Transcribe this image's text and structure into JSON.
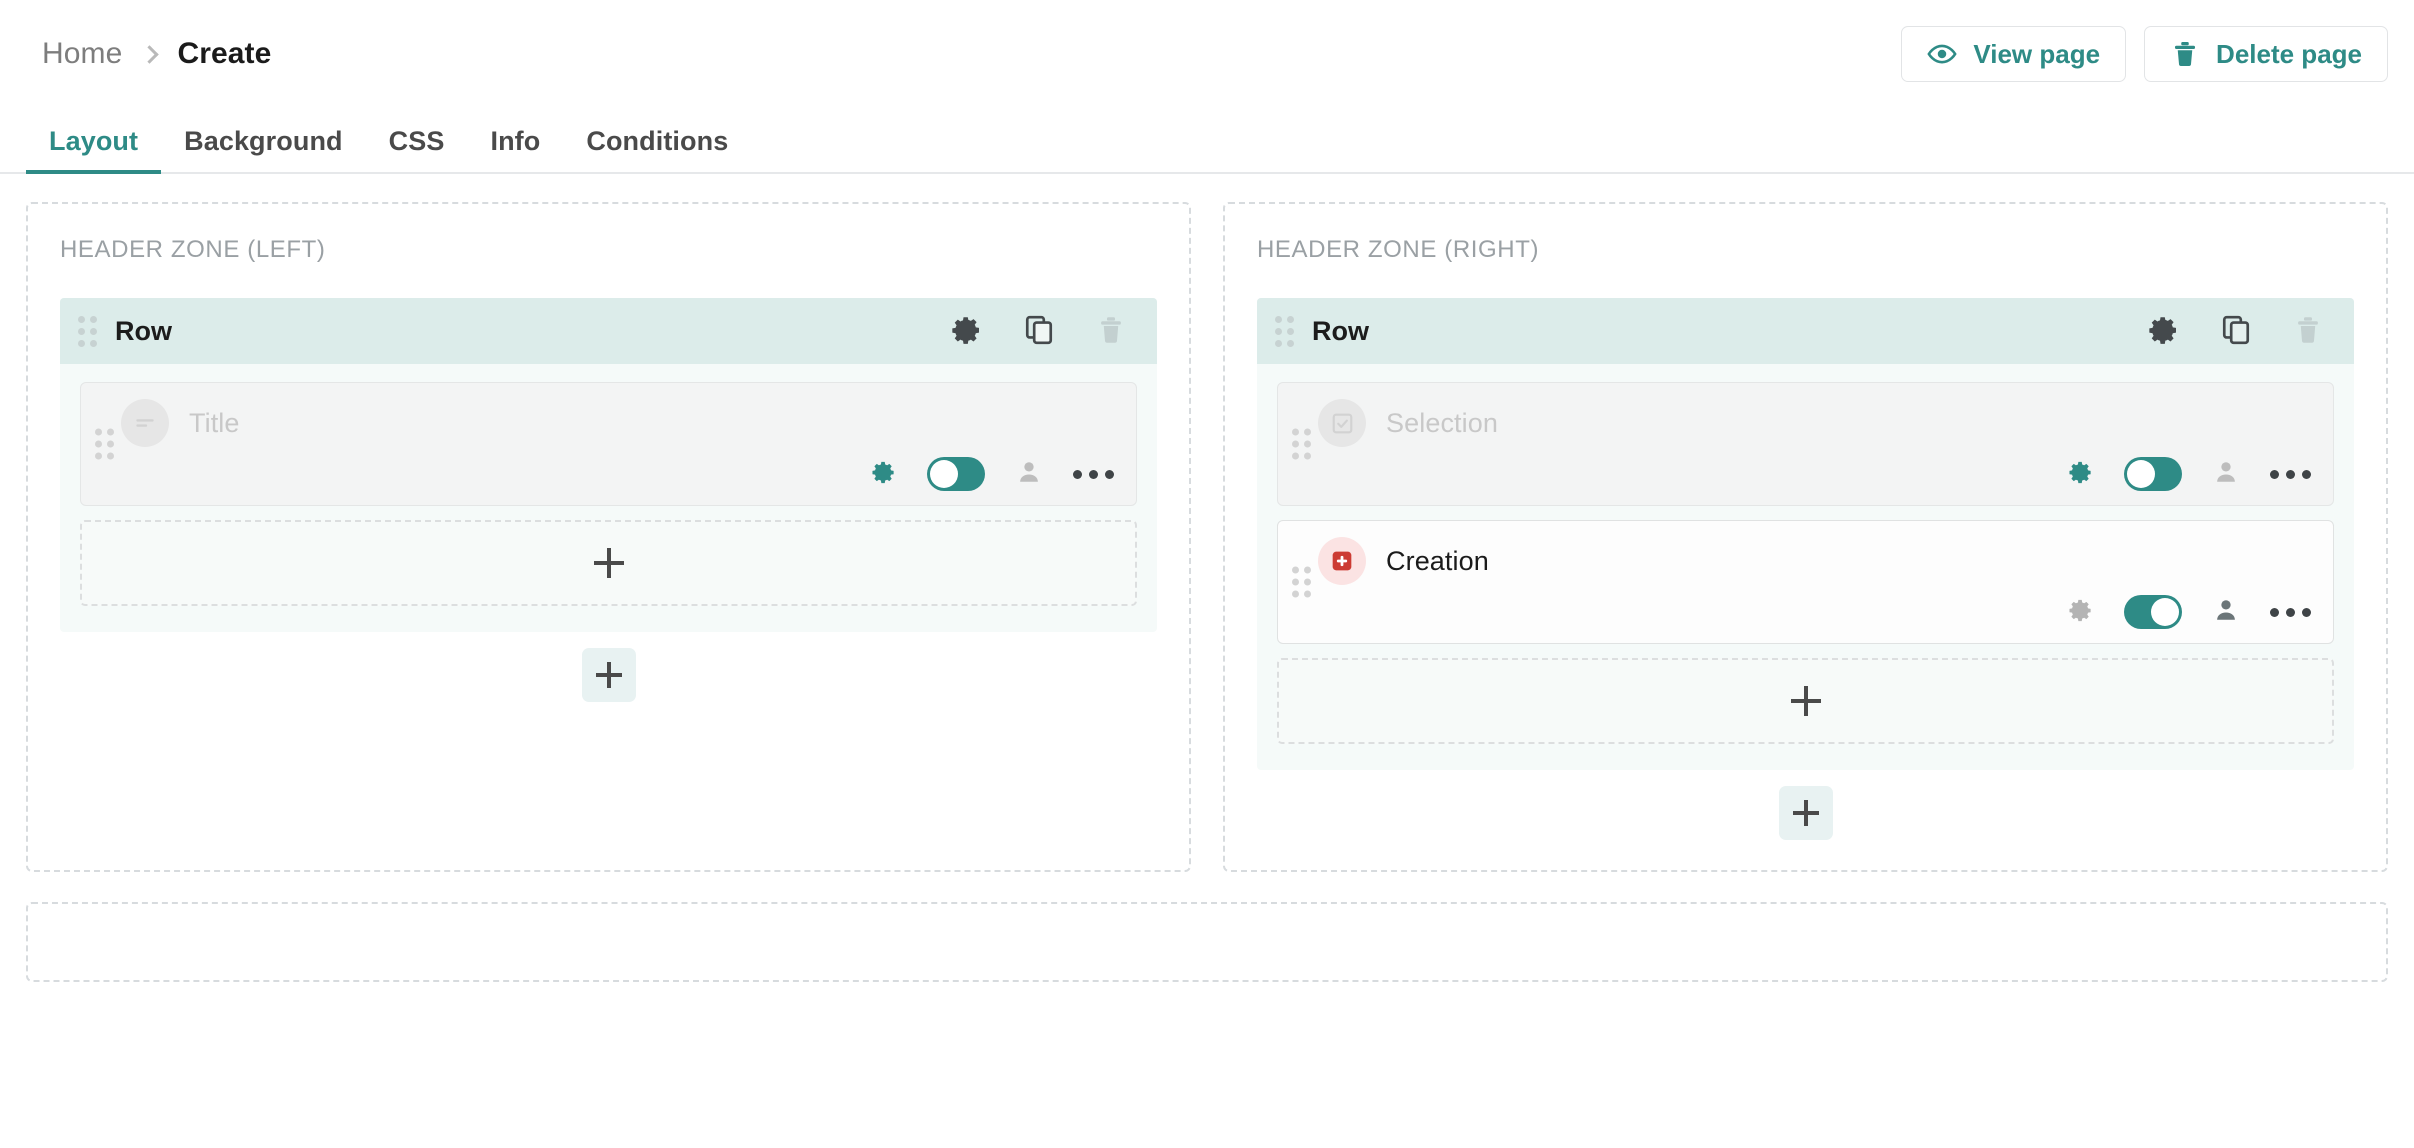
{
  "breadcrumb": {
    "home": "Home",
    "separator_icon": "chevron-right-icon",
    "current": "Create"
  },
  "topbar_actions": [
    {
      "label": "View page",
      "icon": "eye-icon",
      "color": "#2e8b86"
    },
    {
      "label": "Delete page",
      "icon": "trash-icon",
      "color": "#2e8b86"
    }
  ],
  "tabs": [
    {
      "label": "Layout",
      "active": true
    },
    {
      "label": "Background",
      "active": false
    },
    {
      "label": "CSS",
      "active": false
    },
    {
      "label": "Info",
      "active": false
    },
    {
      "label": "Conditions",
      "active": false
    }
  ],
  "colors": {
    "accent": "#2e8b86",
    "row_header_bg": "#dcecea",
    "row_body_bg": "#f5faf9",
    "danger": "#cc3b33",
    "danger_soft": "#fbe3e3",
    "muted_text": "#9aa0a4"
  },
  "zones": [
    {
      "label": "HEADER ZONE (LEFT)",
      "row": {
        "title": "Row",
        "grip_icon": "drag-handle-icon",
        "actions": [
          {
            "icon": "gear-icon",
            "name": "row-settings",
            "state": "enabled"
          },
          {
            "icon": "copy-icon",
            "name": "row-duplicate",
            "state": "enabled"
          },
          {
            "icon": "trash-icon",
            "name": "row-delete",
            "state": "disabled"
          }
        ],
        "widgets": [
          {
            "name": "Title",
            "badge_icon": "text-lines-icon",
            "badge_style": "muted",
            "enabled": false,
            "tools": {
              "gear_icon": "gear-icon",
              "gear_accent": true,
              "toggle_on": false,
              "person_icon": "person-icon",
              "person_accent": false,
              "kebab_icon": "more-horizontal-icon"
            }
          }
        ],
        "add_drop_icon": "plus-icon"
      },
      "add_row_icon": "plus-icon"
    },
    {
      "label": "HEADER ZONE (RIGHT)",
      "row": {
        "title": "Row",
        "grip_icon": "drag-handle-icon",
        "actions": [
          {
            "icon": "gear-icon",
            "name": "row-settings",
            "state": "enabled"
          },
          {
            "icon": "copy-icon",
            "name": "row-duplicate",
            "state": "enabled"
          },
          {
            "icon": "trash-icon",
            "name": "row-delete",
            "state": "disabled"
          }
        ],
        "widgets": [
          {
            "name": "Selection",
            "badge_icon": "checkbox-checked-icon",
            "badge_style": "muted",
            "enabled": false,
            "tools": {
              "gear_icon": "gear-icon",
              "gear_accent": true,
              "toggle_on": false,
              "person_icon": "person-icon",
              "person_accent": false,
              "kebab_icon": "more-horizontal-icon"
            }
          },
          {
            "name": "Creation",
            "badge_icon": "plus-square-icon",
            "badge_style": "danger",
            "enabled": true,
            "tools": {
              "gear_icon": "gear-icon",
              "gear_accent": false,
              "toggle_on": true,
              "person_icon": "person-icon",
              "person_accent": true,
              "kebab_icon": "more-horizontal-icon"
            }
          }
        ],
        "add_drop_icon": "plus-icon"
      },
      "add_row_icon": "plus-icon"
    }
  ]
}
